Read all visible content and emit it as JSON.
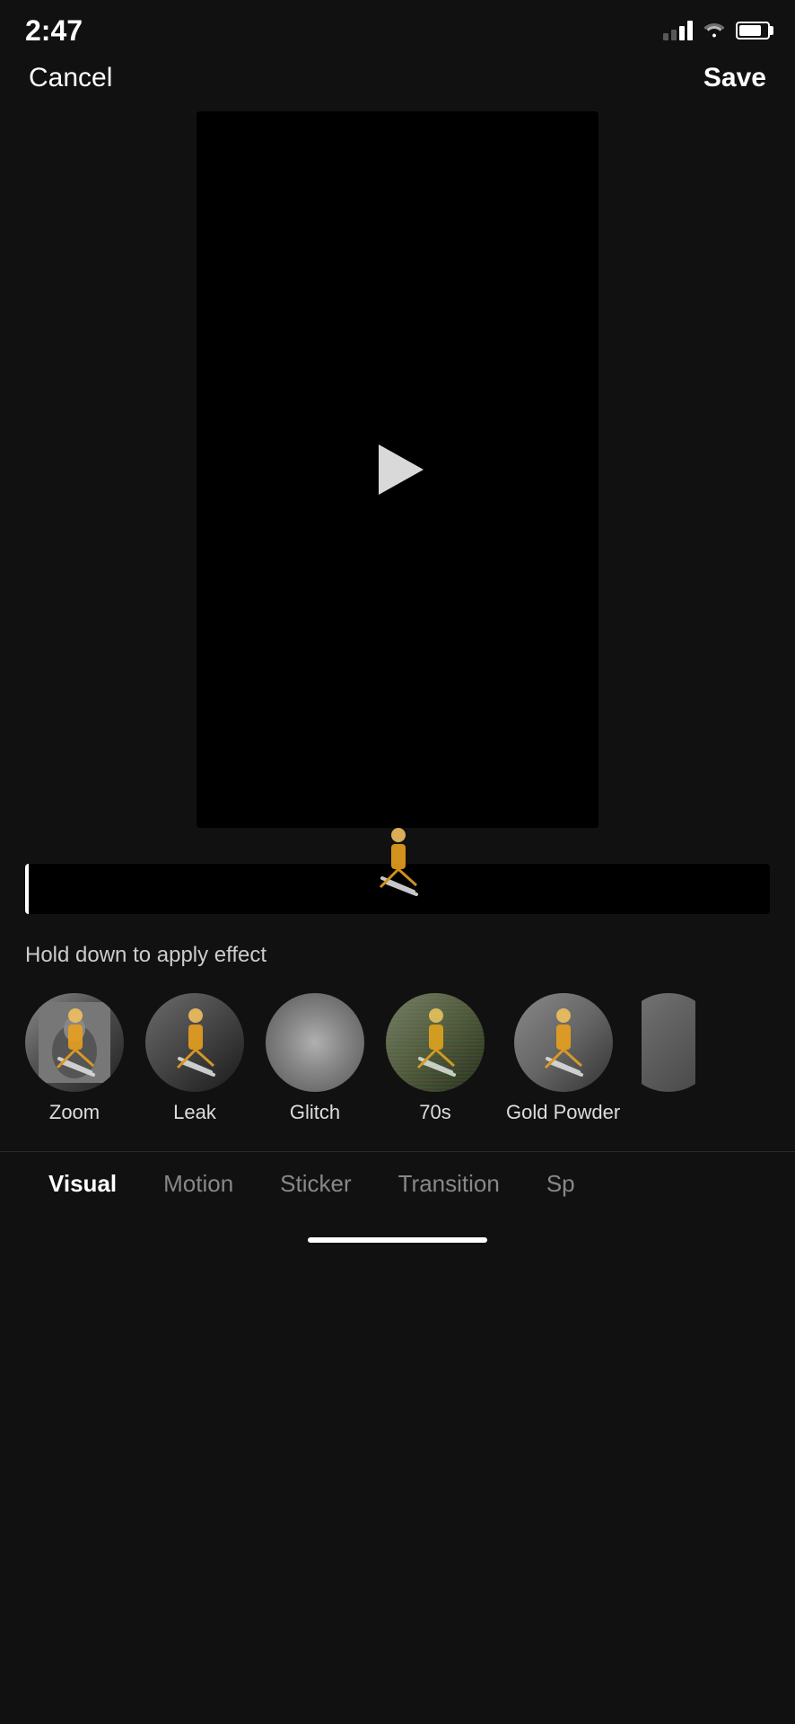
{
  "statusBar": {
    "time": "2:47",
    "signalBars": [
      1,
      2,
      3,
      4
    ],
    "signalActive": 2
  },
  "header": {
    "cancelLabel": "Cancel",
    "saveLabel": "Save"
  },
  "videoPlayer": {
    "isPlaying": false
  },
  "timeline": {
    "holdText": "Hold down to apply effect"
  },
  "effects": [
    {
      "id": "zoom",
      "label": "Zoom",
      "type": "zoom"
    },
    {
      "id": "leak",
      "label": "Leak",
      "type": "leak"
    },
    {
      "id": "glitch",
      "label": "Glitch",
      "type": "glitch"
    },
    {
      "id": "70s",
      "label": "70s",
      "type": "70s"
    },
    {
      "id": "goldpowder",
      "label": "Gold Powder",
      "type": "goldpowder"
    },
    {
      "id": "partial",
      "label": "",
      "type": "partial"
    }
  ],
  "categories": [
    {
      "id": "visual",
      "label": "Visual",
      "active": true
    },
    {
      "id": "motion",
      "label": "Motion",
      "active": false
    },
    {
      "id": "sticker",
      "label": "Sticker",
      "active": false
    },
    {
      "id": "transition",
      "label": "Transition",
      "active": false
    },
    {
      "id": "speed",
      "label": "Sp",
      "active": false
    }
  ]
}
